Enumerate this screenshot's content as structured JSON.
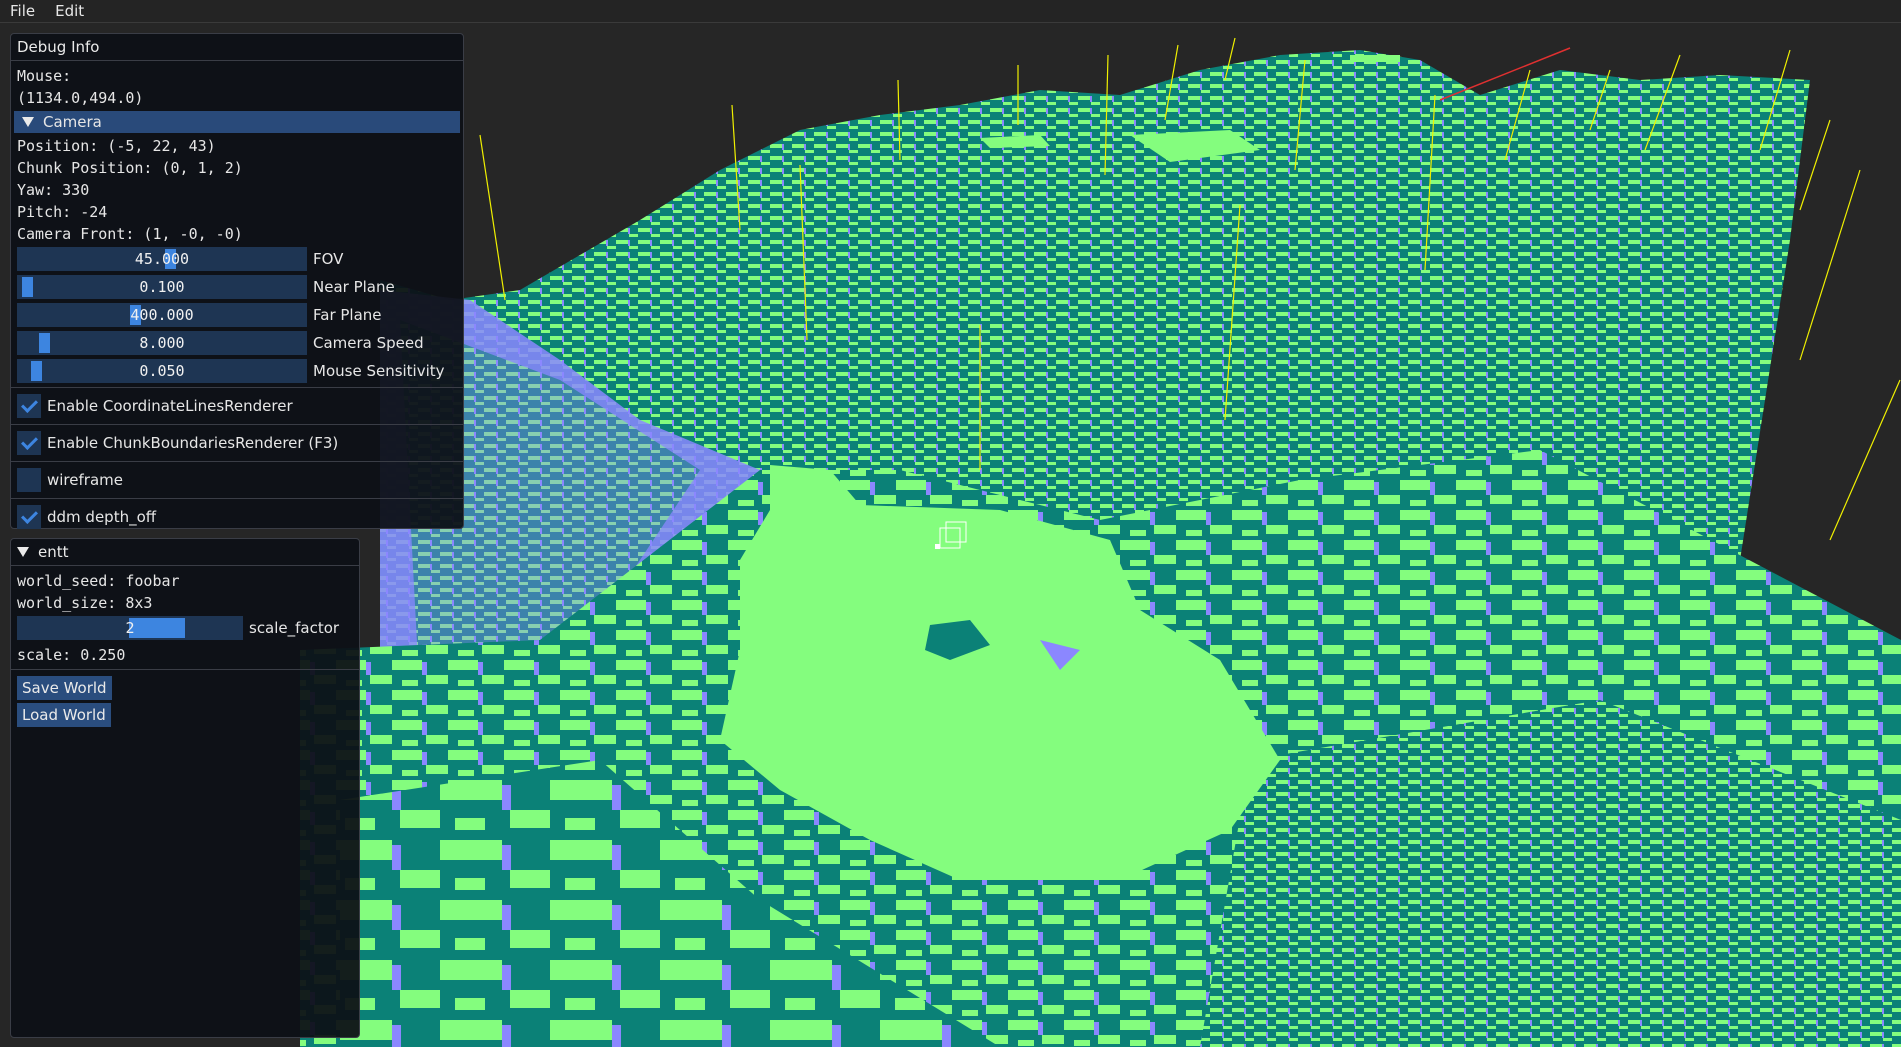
{
  "menubar": {
    "items": [
      "File",
      "Edit"
    ]
  },
  "debug": {
    "title": "Debug Info",
    "mouse_label": "Mouse:",
    "mouse_value": "(1134.0,494.0)",
    "camera_header": "Camera",
    "position": "Position: (-5, 22, 43)",
    "chunk_position": "Chunk Position: (0, 1, 2)",
    "yaw": "Yaw: 330",
    "pitch": "Pitch: -24",
    "camera_front": "Camera Front: (1, -0, -0)",
    "sliders": [
      {
        "value": "45.000",
        "label": "FOV",
        "fraction": 0.5
      },
      {
        "value": "0.100",
        "label": "Near Plane",
        "fraction": 0.02
      },
      {
        "value": "400.000",
        "label": "Far Plane",
        "fraction": 0.4
      },
      {
        "value": "8.000",
        "label": "Camera Speed",
        "fraction": 0.08
      },
      {
        "value": "0.050",
        "label": "Mouse Sensitivity",
        "fraction": 0.05
      }
    ],
    "checkboxes": [
      {
        "label": "Enable CoordinateLinesRenderer",
        "checked": true
      },
      {
        "label": "Enable ChunkBoundariesRenderer (F3)",
        "checked": true
      },
      {
        "label": "wireframe",
        "checked": false
      },
      {
        "label": "ddm depth_off",
        "checked": true
      }
    ]
  },
  "entt": {
    "header": "entt",
    "world_seed": "world_seed: foobar",
    "world_size": "world_size: 8x3",
    "scale_factor": {
      "value": "2",
      "label": "scale_factor",
      "fraction": 0.5
    },
    "scale": "scale: 0.250",
    "save_label": "Save World",
    "load_label": "Load World"
  },
  "colors": {
    "background": "#262626",
    "voxel_top": "#84fd7e",
    "voxel_side": "#0b8177",
    "voxel_shade": "#8b87ff",
    "panel_bg": "#0d1016",
    "accent": "#3d85e0"
  }
}
